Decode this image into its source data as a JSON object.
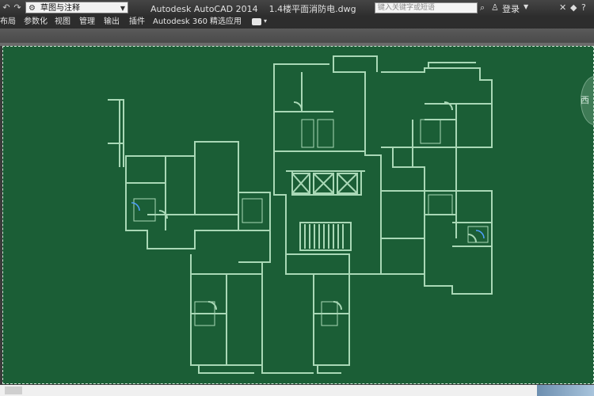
{
  "titlebar": {
    "workspace_label": "草图与注释",
    "app_title": "Autodesk AutoCAD 2014",
    "file_name": "1.4楼平面消防电.dwg",
    "search_placeholder": "键入关键字或短语",
    "login_label": "登录"
  },
  "menubar": {
    "items": [
      "布局",
      "参数化",
      "视图",
      "管理",
      "输出",
      "插件",
      "Autodesk 360",
      "精选应用"
    ]
  },
  "viewcube": {
    "label": "西"
  },
  "colors": {
    "canvas": "#1b5e36",
    "linework": "#a9d8b6"
  }
}
